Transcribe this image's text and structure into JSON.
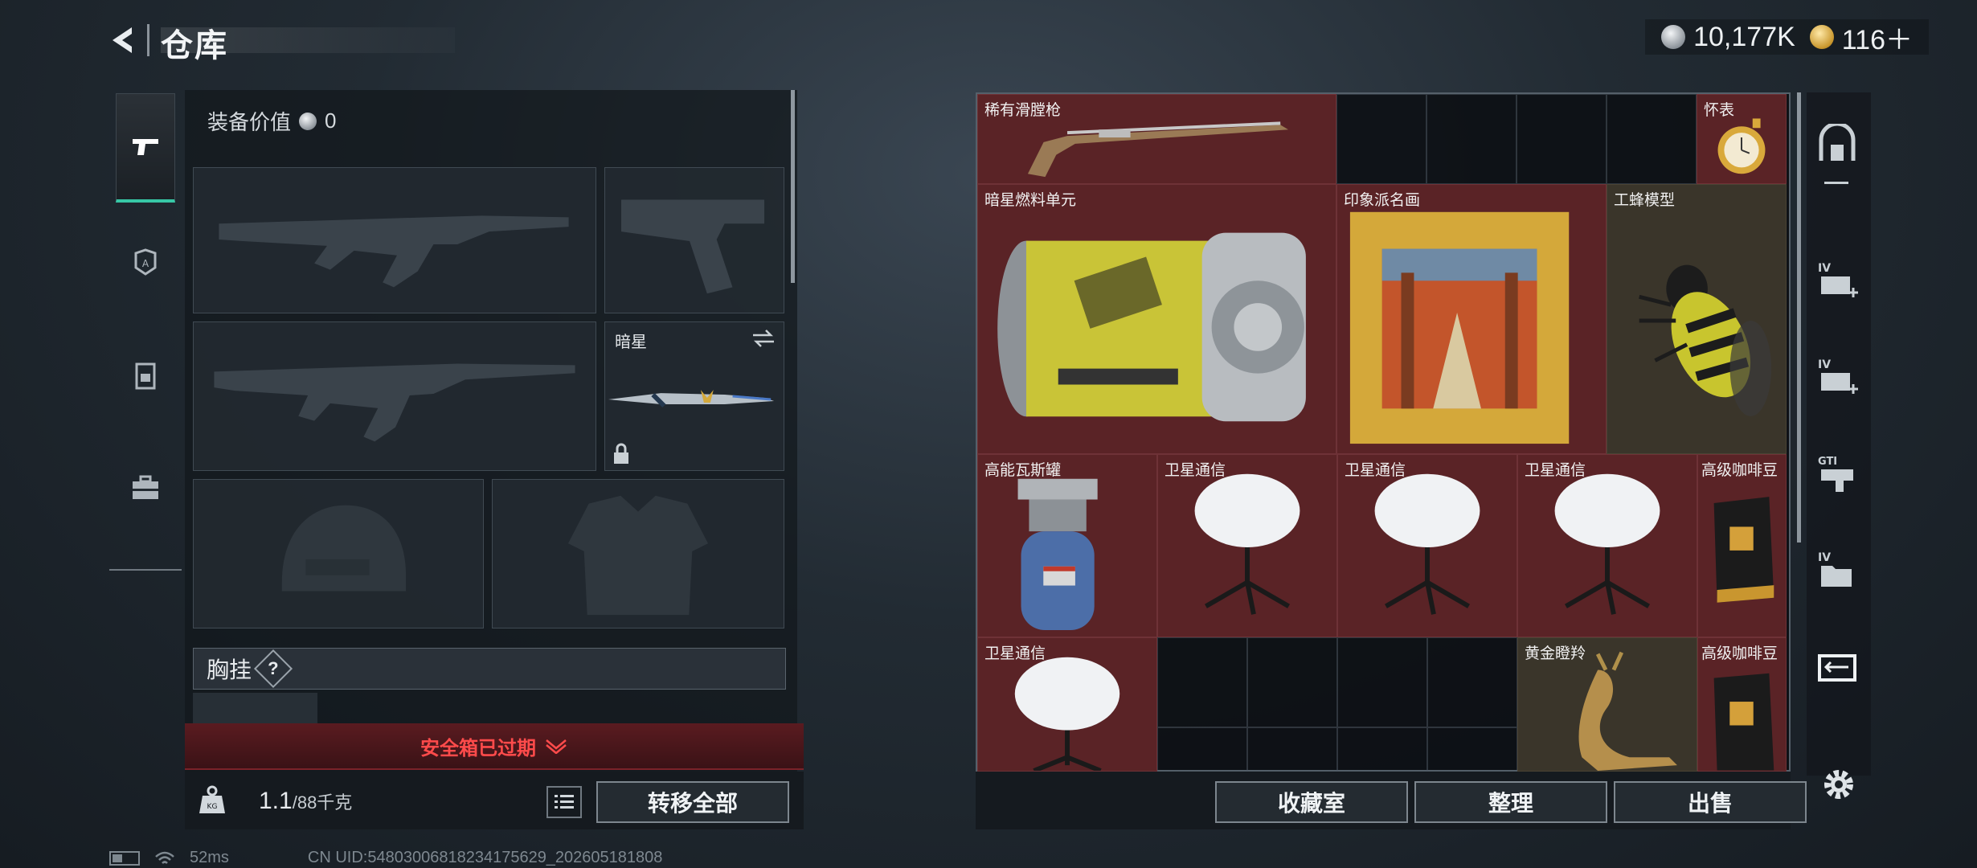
{
  "header": {
    "title": "仓库",
    "currency": [
      {
        "icon": "silver-coin-icon",
        "value": "10,177K"
      },
      {
        "icon": "gold-coin-icon",
        "value": "116＋"
      }
    ]
  },
  "left_rail": {
    "items": [
      {
        "icon": "pistol-icon",
        "active": true
      },
      {
        "icon": "helmet-icon",
        "active": false
      },
      {
        "icon": "backpack-icon",
        "active": false
      },
      {
        "icon": "toolbox-icon",
        "active": false
      }
    ]
  },
  "equipment": {
    "value_label": "装备价值",
    "value": "0",
    "melee_slot_label": "暗星",
    "chest_rig_label": "胸挂",
    "help_glyph": "?"
  },
  "safebox": {
    "status": "安全箱已过期"
  },
  "capacity": {
    "current": "1.1",
    "max": "/88千克",
    "transfer_all_label": "转移全部"
  },
  "status_bar": {
    "ping": "52ms",
    "uid": "CN UID:54803006818234175629_202605181808"
  },
  "storage": {
    "items": [
      {
        "label": "稀有滑膛枪",
        "kind": "musket"
      },
      {
        "label": "怀表",
        "kind": "pocket-watch"
      },
      {
        "label": "暗星燃料单元",
        "kind": "fuel-cell"
      },
      {
        "label": "印象派名画",
        "kind": "painting"
      },
      {
        "label": "工蜂模型",
        "kind": "bee-model"
      },
      {
        "label": "高能瓦斯罐",
        "kind": "gas-canister"
      },
      {
        "label": "卫星通信",
        "kind": "satellite-dish"
      },
      {
        "label": "卫星通信",
        "kind": "satellite-dish"
      },
      {
        "label": "卫星通信",
        "kind": "satellite-dish"
      },
      {
        "label": "高级咖啡豆",
        "kind": "coffee-bag"
      },
      {
        "label": "卫星通信",
        "kind": "satellite-dish"
      },
      {
        "label": "黄金瞪羚",
        "kind": "golden-gazelle"
      },
      {
        "label": "高级咖啡豆",
        "kind": "coffee-bag"
      }
    ],
    "buttons": {
      "collection": "收藏室",
      "sort": "整理",
      "sell": "出售"
    }
  },
  "right_rail": {
    "items": [
      {
        "icon": "safehouse-icon"
      },
      {
        "icon": "weapon-case-icon"
      },
      {
        "icon": "iv-ammo-box-icon",
        "tag": "IV"
      },
      {
        "icon": "iv-medkit-icon",
        "tag": "IV"
      },
      {
        "icon": "gti-gun-icon",
        "tag": "GTI"
      },
      {
        "icon": "iv-folder-icon",
        "tag": "IV"
      },
      {
        "icon": "collection-icon"
      }
    ]
  }
}
